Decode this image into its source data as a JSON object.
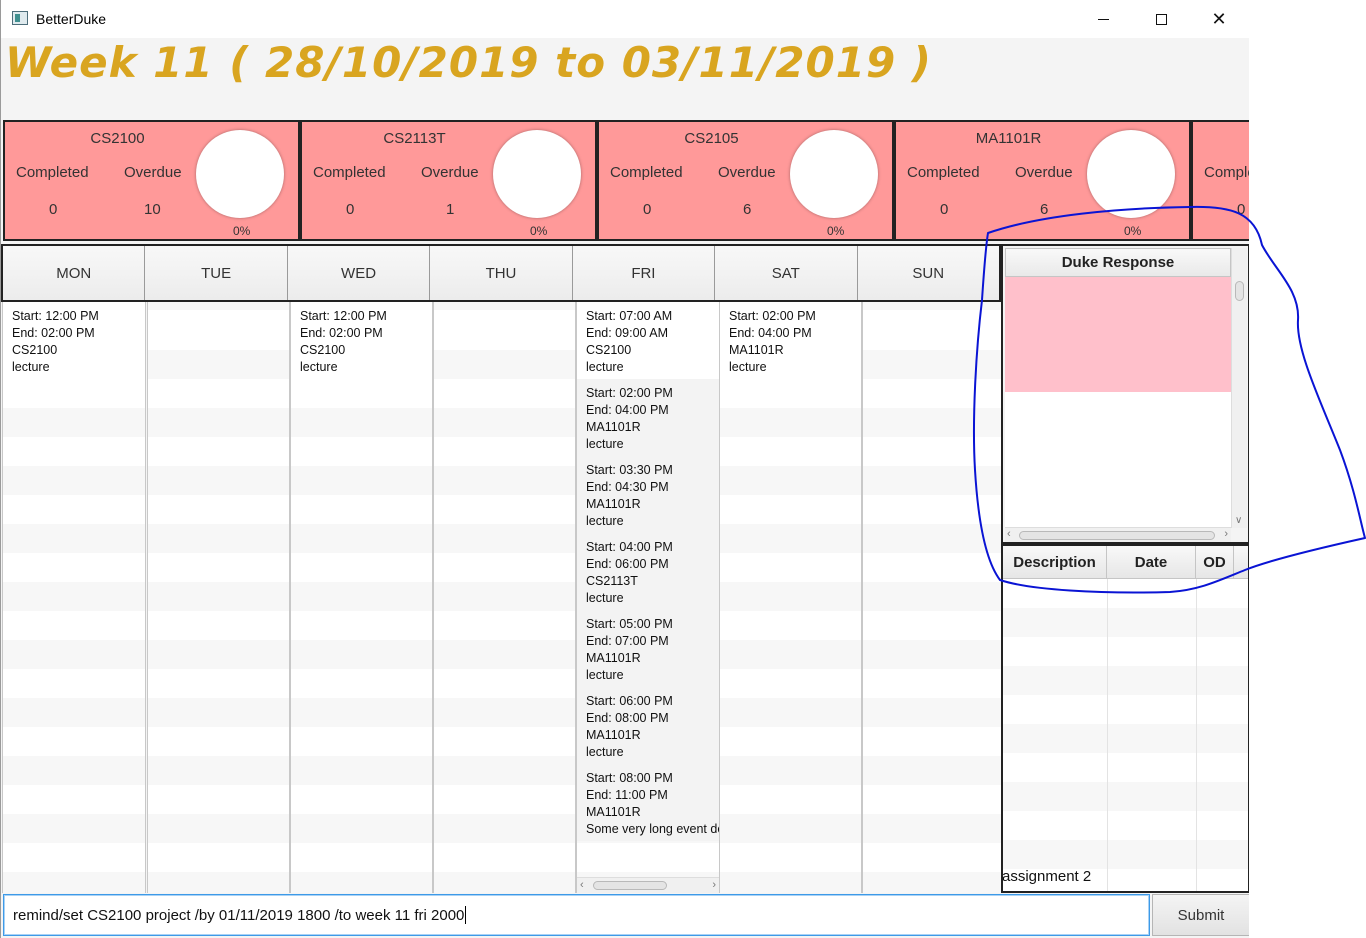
{
  "window": {
    "title": "BetterDuke",
    "controls": {
      "minimize": "minimize",
      "maximize": "maximize",
      "close": "✕"
    }
  },
  "week_title": "Week 11 ( 28/10/2019 to 03/11/2019 )",
  "modules": [
    {
      "name": "CS2100",
      "completed_label": "Completed",
      "overdue_label": "Overdue",
      "completed": "0",
      "overdue": "10",
      "percent": "0%"
    },
    {
      "name": "CS2113T",
      "completed_label": "Completed",
      "overdue_label": "Overdue",
      "completed": "0",
      "overdue": "1",
      "percent": "0%"
    },
    {
      "name": "CS2105",
      "completed_label": "Completed",
      "overdue_label": "Overdue",
      "completed": "0",
      "overdue": "6",
      "percent": "0%"
    },
    {
      "name": "MA1101R",
      "completed_label": "Completed",
      "overdue_label": "Overdue",
      "completed": "0",
      "overdue": "6",
      "percent": "0%"
    },
    {
      "name": "",
      "completed_label": "Comple",
      "overdue_label": "",
      "completed": "0",
      "overdue": "",
      "percent": ""
    }
  ],
  "days": [
    "MON",
    "TUE",
    "WED",
    "THU",
    "FRI",
    "SAT",
    "SUN"
  ],
  "schedule": {
    "mon": [
      {
        "start": "Start: 12:00 PM",
        "end": "End: 02:00 PM",
        "module": "CS2100",
        "desc": "lecture"
      }
    ],
    "tue": [],
    "wed": [
      {
        "start": "Start: 12:00 PM",
        "end": "End: 02:00 PM",
        "module": "CS2100",
        "desc": "lecture"
      }
    ],
    "thu": [],
    "fri": [
      {
        "start": "Start: 07:00 AM",
        "end": "End: 09:00 AM",
        "module": "CS2100",
        "desc": "lecture"
      },
      {
        "start": "Start: 02:00 PM",
        "end": "End: 04:00 PM",
        "module": "MA1101R",
        "desc": "lecture"
      },
      {
        "start": "Start: 03:30 PM",
        "end": "End: 04:30 PM",
        "module": "MA1101R",
        "desc": "lecture"
      },
      {
        "start": "Start: 04:00 PM",
        "end": "End: 06:00 PM",
        "module": "CS2113T",
        "desc": "lecture"
      },
      {
        "start": "Start: 05:00 PM",
        "end": "End: 07:00 PM",
        "module": "MA1101R",
        "desc": "lecture"
      },
      {
        "start": "Start: 06:00 PM",
        "end": "End: 08:00 PM",
        "module": "MA1101R",
        "desc": "lecture"
      },
      {
        "start": "Start: 08:00 PM",
        "end": "End: 11:00 PM",
        "module": "MA1101R",
        "desc": "Some very long event de"
      }
    ],
    "sat": [
      {
        "start": "Start: 02:00 PM",
        "end": "End: 04:00 PM",
        "module": "MA1101R",
        "desc": "lecture"
      }
    ],
    "sun": []
  },
  "duke_response": {
    "header": "Duke Response",
    "text": ""
  },
  "reminders": {
    "columns": [
      "Description",
      "Date",
      "OD"
    ],
    "rows": [
      {
        "description": "assignment 2",
        "date": "",
        "od": ""
      }
    ]
  },
  "command": {
    "value": "remind/set CS2100 project /by 01/11/2019 1800 /to week 11 fri 2000",
    "submit_label": "Submit"
  },
  "colors": {
    "week_title": "#d9a520",
    "module_card": "#ff9999",
    "duke_response_bg": "#ffc0cb",
    "annotation": "#0a14d4"
  }
}
